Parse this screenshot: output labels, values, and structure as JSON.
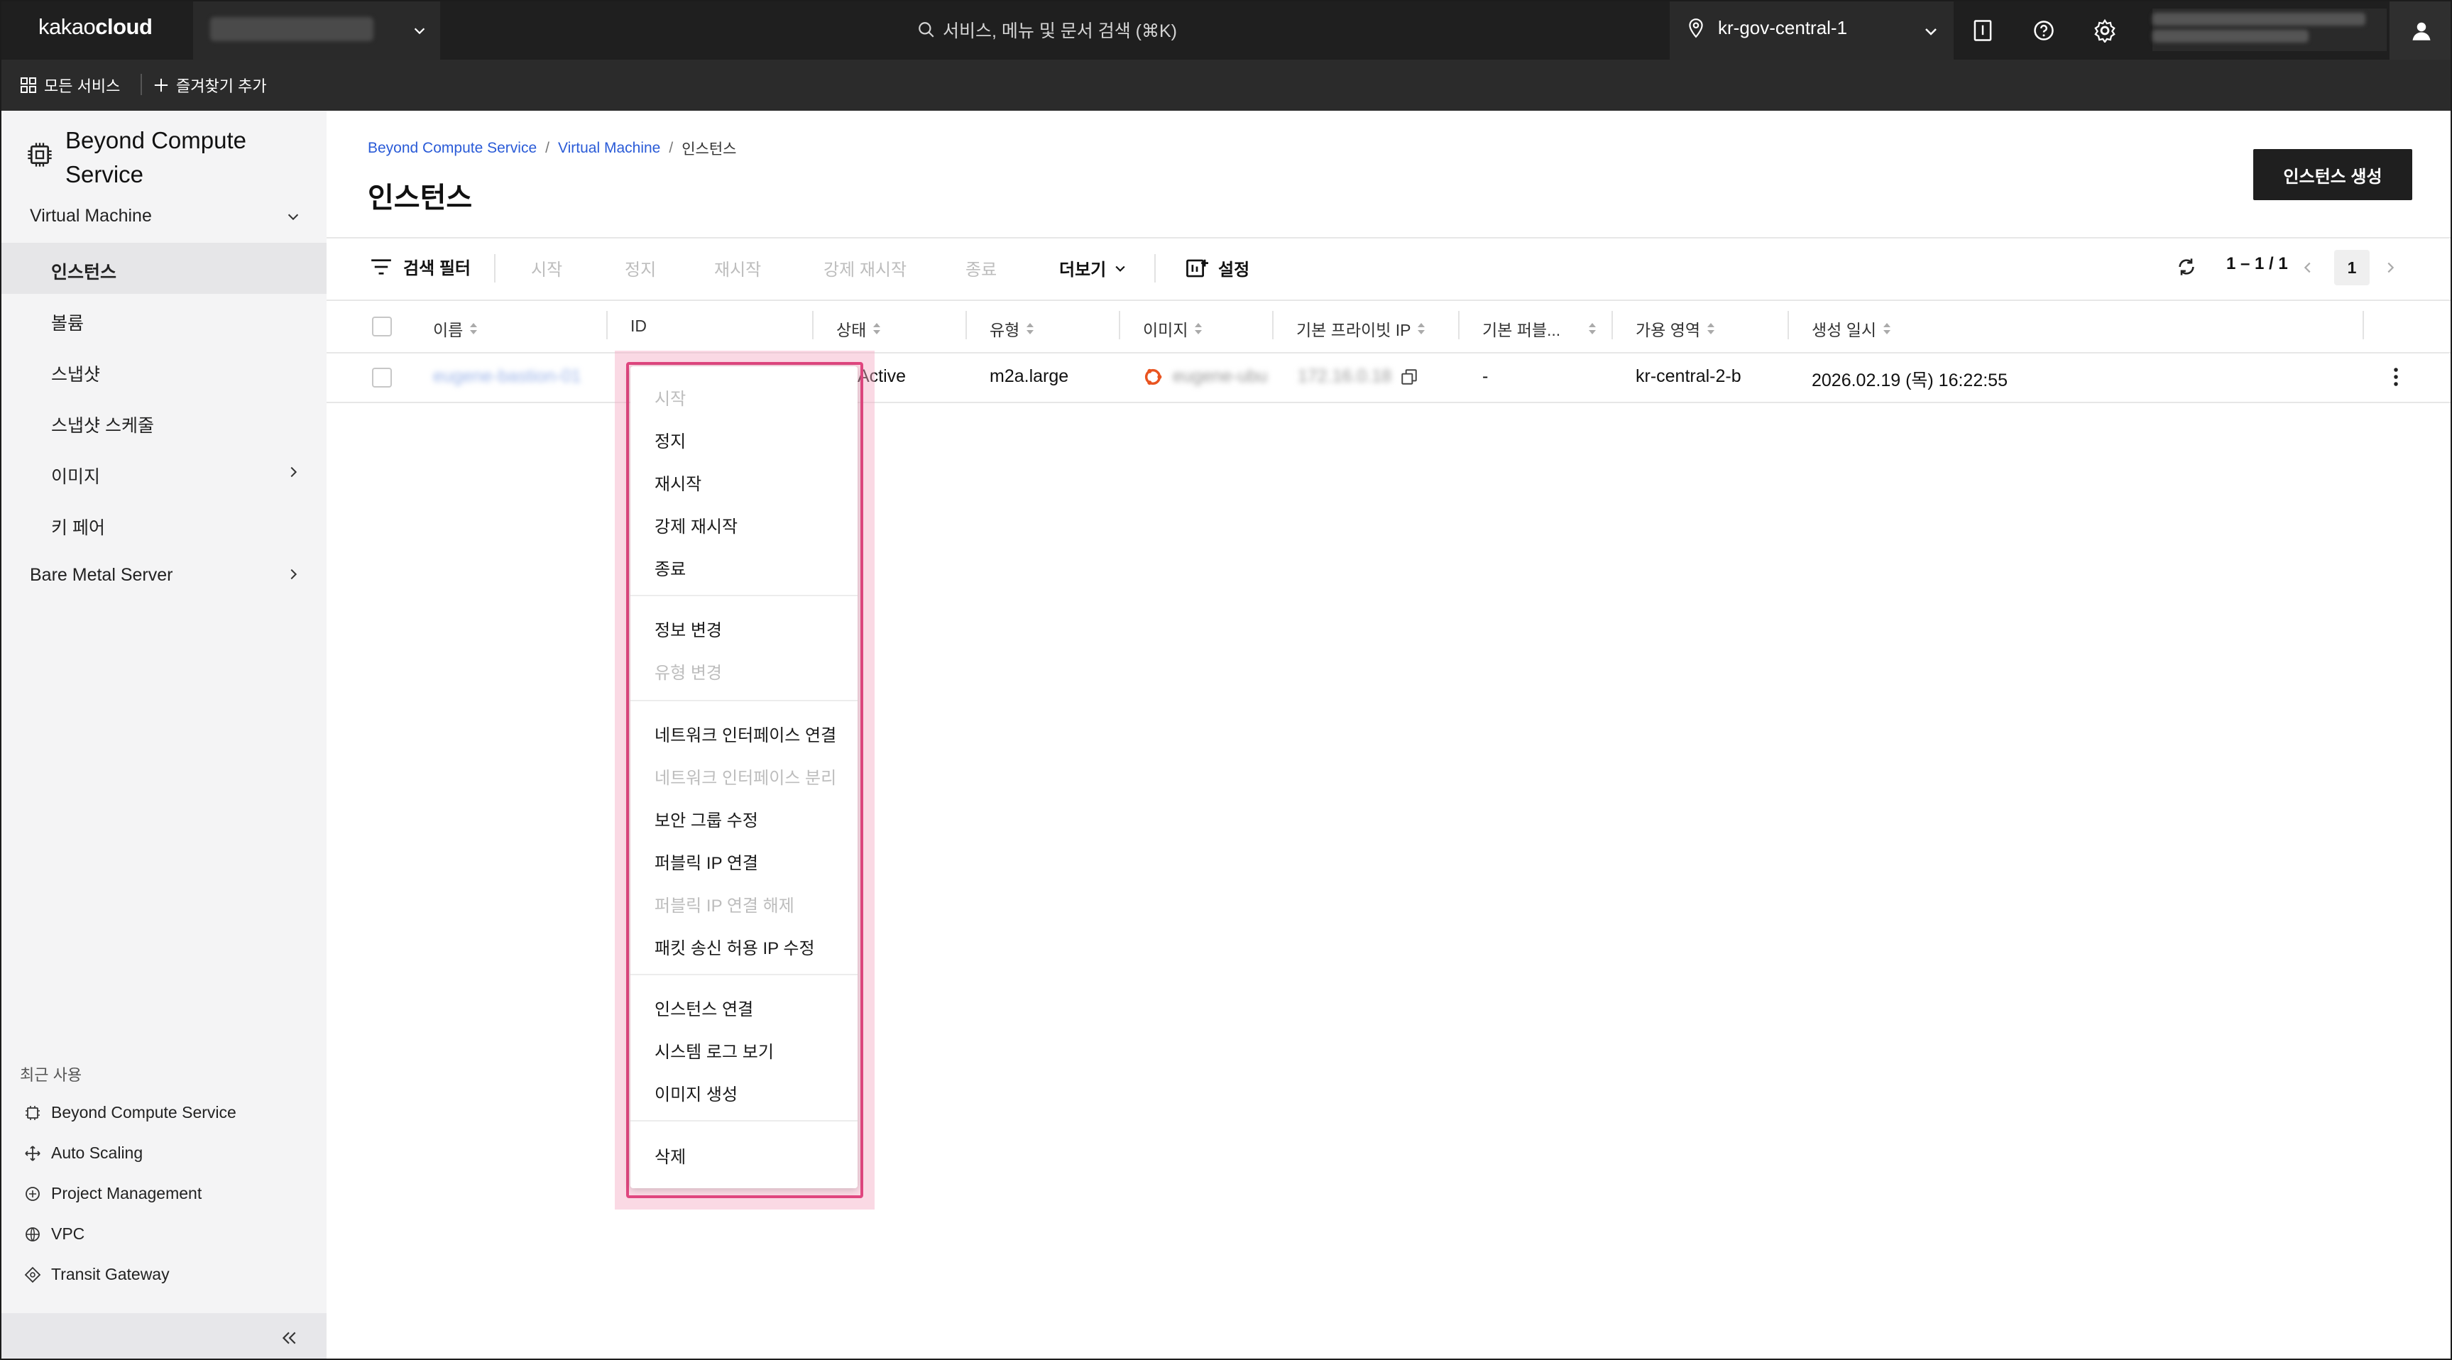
{
  "topbar": {
    "logo_light": "kakao",
    "logo_bold": "cloud",
    "search_placeholder": "서비스, 메뉴 및 문서 검색 (⌘K)",
    "region": "kr-gov-central-1",
    "icons": [
      "location-pin-icon",
      "chevron-down-icon",
      "book-icon",
      "help-icon",
      "gear-icon",
      "user-icon"
    ]
  },
  "subbar": {
    "all_services": "모든 서비스",
    "add_favorite": "즐겨찾기 추가"
  },
  "sidebar": {
    "title": "Beyond Compute Service",
    "section_vm": "Virtual Machine",
    "items": [
      {
        "label": "인스턴스",
        "active": true
      },
      {
        "label": "볼륨"
      },
      {
        "label": "스냅샷"
      },
      {
        "label": "스냅샷 스케줄"
      },
      {
        "label": "이미지"
      },
      {
        "label": "키 페어"
      }
    ],
    "section_bms": "Bare Metal Server",
    "recent_title": "최근 사용",
    "recent": [
      {
        "label": "Beyond Compute Service",
        "icon": "chip-icon"
      },
      {
        "label": "Auto Scaling",
        "icon": "autoscaling-icon"
      },
      {
        "label": "Project Management",
        "icon": "project-icon"
      },
      {
        "label": "VPC",
        "icon": "vpc-icon"
      },
      {
        "label": "Transit Gateway",
        "icon": "transit-gateway-icon"
      }
    ]
  },
  "breadcrumb": [
    "Beyond Compute Service",
    "Virtual Machine",
    "인스턴스"
  ],
  "page_title": "인스턴스",
  "create_button": "인스턴스 생성",
  "toolbar": {
    "filter": "검색 필터",
    "start": "시작",
    "stop": "정지",
    "restart": "재시작",
    "force_restart": "강제 재시작",
    "terminate": "종료",
    "more": "더보기",
    "settings": "설정",
    "range": "1 – 1 / 1",
    "page": "1"
  },
  "table": {
    "headers": [
      "이름",
      "ID",
      "상태",
      "유형",
      "이미지",
      "기본 프라이빗 IP",
      "기본 퍼블...",
      "가용 영역",
      "생성 일시"
    ],
    "row": {
      "status": "Active",
      "type": "m2a.large",
      "public_ip": "-",
      "zone": "kr-central-2-b",
      "created": "2026.02.19 (목) 16:22:55"
    }
  },
  "context_menu": {
    "groups": [
      [
        {
          "label": "시작",
          "disabled": true
        },
        {
          "label": "정지"
        },
        {
          "label": "재시작"
        },
        {
          "label": "강제 재시작"
        },
        {
          "label": "종료"
        }
      ],
      [
        {
          "label": "정보 변경"
        },
        {
          "label": "유형 변경",
          "disabled": true
        }
      ],
      [
        {
          "label": "네트워크 인터페이스 연결"
        },
        {
          "label": "네트워크 인터페이스 분리",
          "disabled": true
        },
        {
          "label": "보안 그룹 수정"
        },
        {
          "label": "퍼블릭 IP 연결"
        },
        {
          "label": "퍼블릭 IP 연결 해제",
          "disabled": true
        },
        {
          "label": "패킷 송신 허용 IP 수정"
        }
      ],
      [
        {
          "label": "인스턴스 연결"
        },
        {
          "label": "시스템 로그 보기"
        },
        {
          "label": "이미지 생성"
        }
      ],
      [
        {
          "label": "삭제"
        }
      ]
    ]
  },
  "colors": {
    "accent_link": "#2a5bd7",
    "highlight": "#e0467f",
    "topbar": "#1f1f1f",
    "status_active": "#2fb344"
  }
}
